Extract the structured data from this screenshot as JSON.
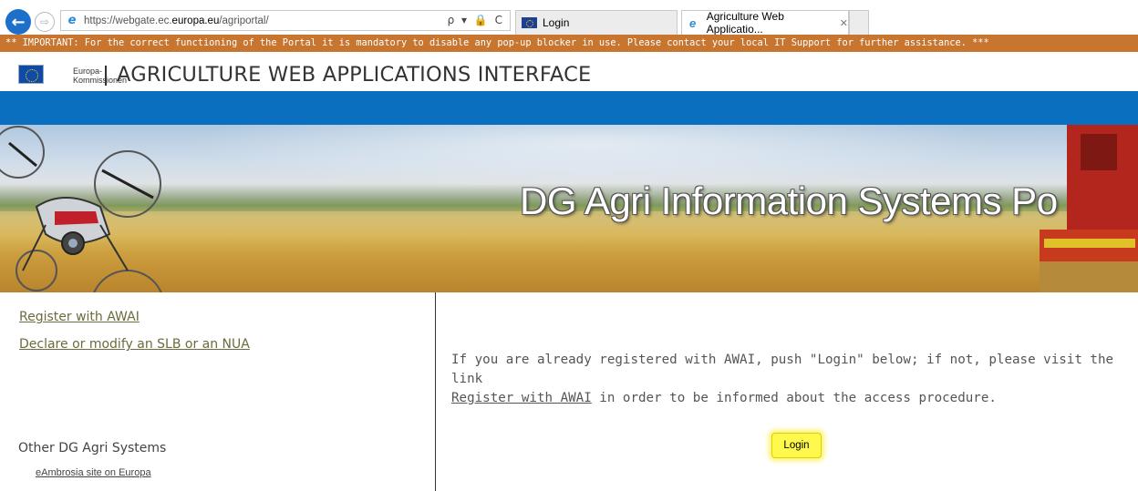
{
  "browser": {
    "address_url_prefix": "https://webgate.ec.",
    "address_url_domain": "europa.eu",
    "address_url_path": "/agriportal/",
    "address_tools": "ρ ▾ 🔒 C",
    "tabs": [
      {
        "label": "Login",
        "icon": "eu-flag-icon",
        "active": false
      },
      {
        "label": "Agriculture Web Applicatio...",
        "icon": "ie-icon",
        "active": true
      }
    ],
    "tab_close": "✕"
  },
  "notice": {
    "text": "** IMPORTANT:  For the correct functioning of the Portal it is mandatory to disable any pop-up blocker in use. Please contact your local IT Support for further assistance. ***"
  },
  "header": {
    "org_line1": "Europa-",
    "org_line2": "Kommissionen",
    "title": "AGRICULTURE WEB APPLICATIONS INTERFACE"
  },
  "banner": {
    "title": "DG Agri Information Systems Po"
  },
  "sidebar": {
    "links": [
      {
        "label": "Register with AWAI"
      },
      {
        "label": "Declare or modify an SLB or an NUA"
      }
    ],
    "other_heading": "Other DG Agri Systems",
    "other_links": [
      {
        "label": "eAmbrosia site on Europa"
      }
    ]
  },
  "main": {
    "info_before": "If you are already registered with AWAI, push \"Login\" below; if not, please visit the link",
    "info_link": "Register with AWAI",
    "info_after": " in order to be informed about the access procedure.",
    "login_label": "Login"
  },
  "colors": {
    "notice_bg": "#c7752f",
    "blue_bar": "#0b6fc0",
    "link_color": "#6b6b3c",
    "login_highlight": "#fff84d"
  }
}
